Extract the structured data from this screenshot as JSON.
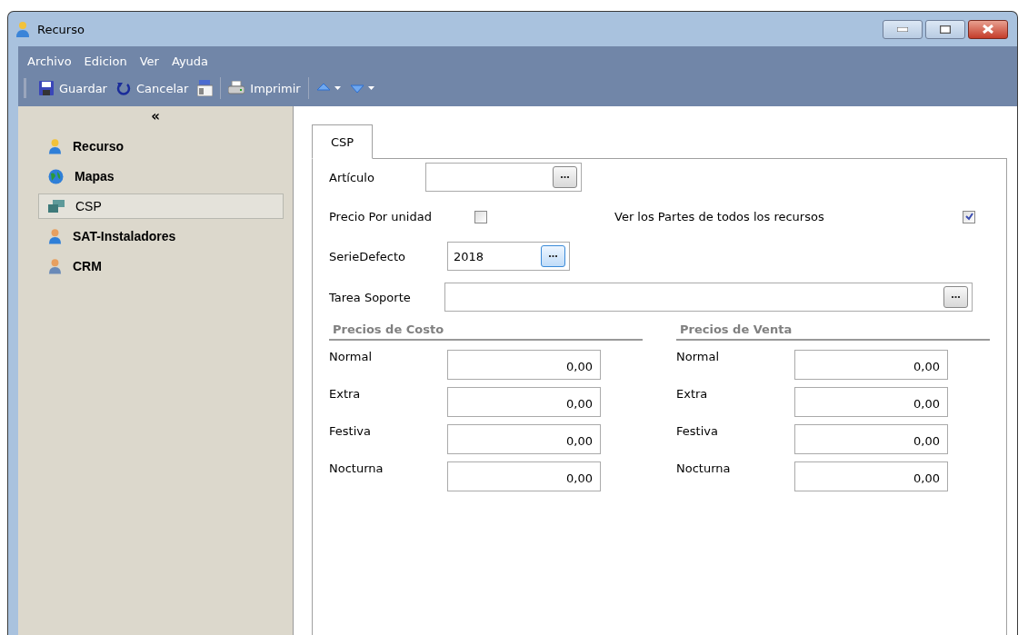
{
  "window": {
    "title": "Recurso"
  },
  "menu": [
    "Archivo",
    "Edicion",
    "Ver",
    "Ayuda"
  ],
  "toolbar": [
    {
      "kind": "button",
      "label": "Guardar"
    },
    {
      "kind": "button",
      "label": "Cancelar"
    },
    {
      "kind": "icon"
    },
    {
      "kind": "separator"
    },
    {
      "kind": "button",
      "label": "Imprimir"
    },
    {
      "kind": "separator"
    },
    {
      "kind": "dropdown"
    },
    {
      "kind": "dropdown"
    }
  ],
  "sidebar": {
    "collapse": "«",
    "items": [
      {
        "label": "Recurso",
        "selected": false
      },
      {
        "label": "Mapas",
        "selected": false
      },
      {
        "label": "CSP",
        "selected": true
      },
      {
        "label": "SAT-Instaladores",
        "selected": false
      },
      {
        "label": "CRM",
        "selected": false
      }
    ]
  },
  "tabs": [
    {
      "label": "CSP",
      "selected": true
    }
  ],
  "form": {
    "articulo": {
      "label": "Artículo"
    },
    "precio_por_unidad": {
      "label": "Precio Por unidad",
      "checked": false
    },
    "ver_partes": {
      "label": "Ver los Partes de todos los recursos",
      "checked": true
    },
    "serie": {
      "label": "SerieDefecto",
      "value": "2018"
    },
    "tarea": {
      "label": "Tarea Soporte"
    }
  },
  "price_groups": [
    {
      "title": "Precios de Costo",
      "rows": [
        {
          "label": "Normal",
          "value": "0,00"
        },
        {
          "label": "Extra",
          "value": "0,00"
        },
        {
          "label": "Festiva",
          "value": "0,00"
        },
        {
          "label": "Nocturna",
          "value": "0,00"
        }
      ]
    },
    {
      "title": "Precios de Venta",
      "rows": [
        {
          "label": "Normal",
          "value": "0,00"
        },
        {
          "label": "Extra",
          "value": "0,00"
        },
        {
          "label": "Festiva",
          "value": "0,00"
        },
        {
          "label": "Nocturna",
          "value": "0,00"
        }
      ]
    }
  ]
}
